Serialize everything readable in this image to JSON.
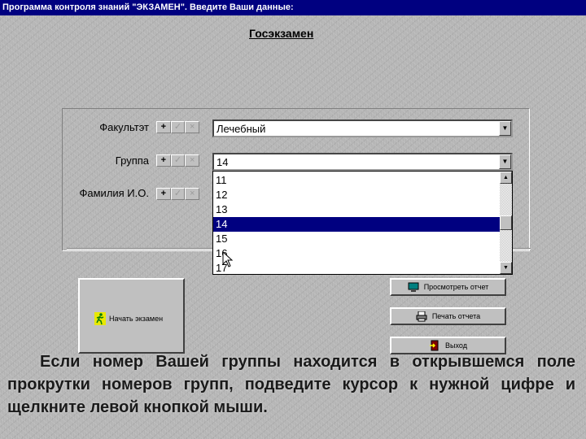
{
  "window": {
    "title": "Программа контроля знаний \"ЭКЗАМЕН\". Введите Ваши данные:"
  },
  "heading": "Госэкзамен",
  "form": {
    "faculty": {
      "label": "Факультэт",
      "value": "Лечебный"
    },
    "group": {
      "label": "Группа",
      "value": "14"
    },
    "name": {
      "label": "Фамилия И.О."
    },
    "toolbar_glyphs": {
      "add": "+",
      "confirm": "✓",
      "cancel": "×"
    }
  },
  "dropdown": {
    "items": [
      "11",
      "12",
      "13",
      "14",
      "15",
      "16",
      "17"
    ],
    "selected": "14"
  },
  "buttons": {
    "start_exam": "Начать экзамен",
    "view_report": "Просмотреть отчет",
    "print_report": "Печать отчета",
    "exit": "Выход"
  },
  "caption": "Если номер Вашей группы находится в открывшемся поле прокрутки номеров групп, подведите курсор к нужной цифре и щелкните левой кнопкой мыши.",
  "colors": {
    "title_bar": "#000080",
    "selection": "#000080",
    "face": "#c0c0c0"
  }
}
